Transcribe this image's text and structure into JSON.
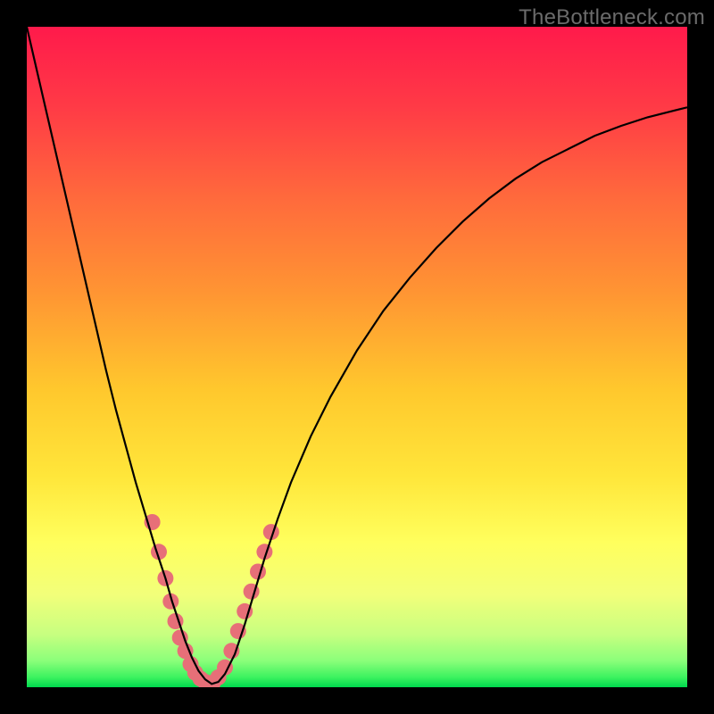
{
  "watermark": "TheBottleneck.com",
  "chart_data": {
    "type": "line",
    "title": "",
    "xlabel": "",
    "ylabel": "",
    "xlim": [
      0,
      100
    ],
    "ylim": [
      0,
      100
    ],
    "grid": false,
    "legend": false,
    "gradient_stops": [
      {
        "offset": 0.0,
        "color": "#ff1a4b"
      },
      {
        "offset": 0.12,
        "color": "#ff3a46"
      },
      {
        "offset": 0.26,
        "color": "#ff6a3c"
      },
      {
        "offset": 0.4,
        "color": "#ff9433"
      },
      {
        "offset": 0.55,
        "color": "#ffc82d"
      },
      {
        "offset": 0.68,
        "color": "#ffe63a"
      },
      {
        "offset": 0.78,
        "color": "#ffff5d"
      },
      {
        "offset": 0.86,
        "color": "#f2ff7a"
      },
      {
        "offset": 0.92,
        "color": "#c7ff80"
      },
      {
        "offset": 0.96,
        "color": "#8bff7a"
      },
      {
        "offset": 0.985,
        "color": "#3cf25f"
      },
      {
        "offset": 1.0,
        "color": "#00d94f"
      }
    ],
    "series": [
      {
        "name": "bottleneck-curve",
        "color": "#000000",
        "stroke_width": 2.2,
        "x": [
          0.0,
          1.5,
          3.0,
          4.5,
          6.0,
          7.5,
          9.0,
          10.5,
          12.0,
          13.5,
          15.0,
          16.5,
          18.0,
          19.5,
          21.0,
          22.0,
          23.0,
          24.0,
          25.0,
          26.0,
          27.0,
          28.0,
          29.0,
          30.0,
          31.5,
          33.0,
          34.5,
          36.0,
          38.0,
          40.0,
          43.0,
          46.0,
          50.0,
          54.0,
          58.0,
          62.0,
          66.0,
          70.0,
          74.0,
          78.0,
          82.0,
          86.0,
          90.0,
          94.0,
          98.0,
          100.0
        ],
        "y": [
          100.0,
          93.5,
          87.0,
          80.5,
          74.0,
          67.5,
          61.0,
          54.5,
          48.0,
          42.0,
          36.5,
          31.0,
          26.0,
          21.0,
          16.5,
          13.0,
          10.0,
          7.0,
          4.5,
          2.5,
          1.2,
          0.5,
          0.8,
          2.0,
          5.0,
          9.5,
          14.5,
          19.5,
          25.5,
          31.0,
          38.0,
          44.0,
          51.0,
          57.0,
          62.0,
          66.5,
          70.5,
          74.0,
          77.0,
          79.5,
          81.5,
          83.5,
          85.0,
          86.3,
          87.3,
          87.8
        ]
      }
    ],
    "points": {
      "name": "data-points",
      "color": "#e76f78",
      "radius": 9,
      "x": [
        19.0,
        20.0,
        21.0,
        21.8,
        22.5,
        23.2,
        24.0,
        24.8,
        25.5,
        26.3,
        27.0,
        27.6,
        28.2,
        29.0,
        30.0,
        31.0,
        32.0,
        33.0,
        34.0,
        35.0,
        36.0,
        37.0
      ],
      "y": [
        25.0,
        20.5,
        16.5,
        13.0,
        10.0,
        7.5,
        5.5,
        3.5,
        2.2,
        1.3,
        0.8,
        0.6,
        0.7,
        1.5,
        3.0,
        5.5,
        8.5,
        11.5,
        14.5,
        17.5,
        20.5,
        23.5
      ]
    }
  }
}
